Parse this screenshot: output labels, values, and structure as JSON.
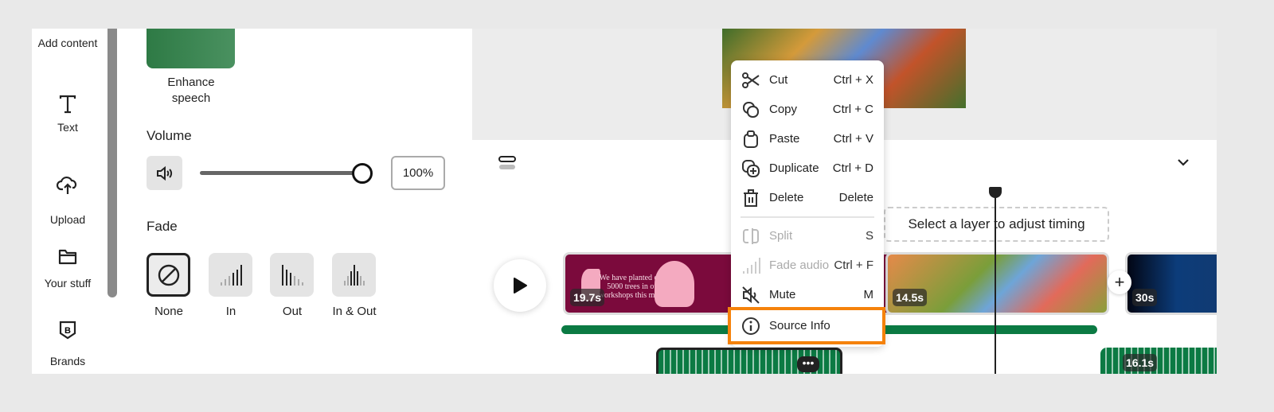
{
  "rail": [
    {
      "label": "Add content",
      "icon": "add-content-icon"
    },
    {
      "label": "Text",
      "icon": "text-icon"
    },
    {
      "label": "Upload",
      "icon": "upload-cloud-icon"
    },
    {
      "label": "Your stuff",
      "icon": "folder-icon"
    },
    {
      "label": "Brands",
      "icon": "brand-icon"
    }
  ],
  "panel": {
    "enhance_label": "Enhance speech",
    "volume_title": "Volume",
    "volume_value": "100%",
    "volume_level": 1.0,
    "fade_title": "Fade",
    "fade_options": [
      "None",
      "In",
      "Out",
      "In & Out"
    ],
    "fade_selected": "None"
  },
  "timeline": {
    "hint": "Select a layer to adjust timing",
    "clips": [
      "19.7s",
      "14.5s",
      "30s"
    ],
    "audio_clips": [
      "16.1s"
    ]
  },
  "menu": {
    "items": [
      {
        "label": "Cut",
        "shortcut": "Ctrl + X",
        "enabled": true
      },
      {
        "label": "Copy",
        "shortcut": "Ctrl + C",
        "enabled": true
      },
      {
        "label": "Paste",
        "shortcut": "Ctrl + V",
        "enabled": true
      },
      {
        "label": "Duplicate",
        "shortcut": "Ctrl + D",
        "enabled": true
      },
      {
        "label": "Delete",
        "shortcut": "Delete",
        "enabled": true
      },
      {
        "label": "Split",
        "shortcut": "S",
        "enabled": false
      },
      {
        "label": "Fade audio",
        "shortcut": "Ctrl + F",
        "enabled": false
      },
      {
        "label": "Mute",
        "shortcut": "M",
        "enabled": true
      },
      {
        "label": "Source Info",
        "shortcut": "",
        "enabled": true
      }
    ]
  },
  "colors": {
    "highlight": "#f5820b",
    "accent_green": "#0b7a43",
    "clip_maroon": "#7b0a3c"
  }
}
